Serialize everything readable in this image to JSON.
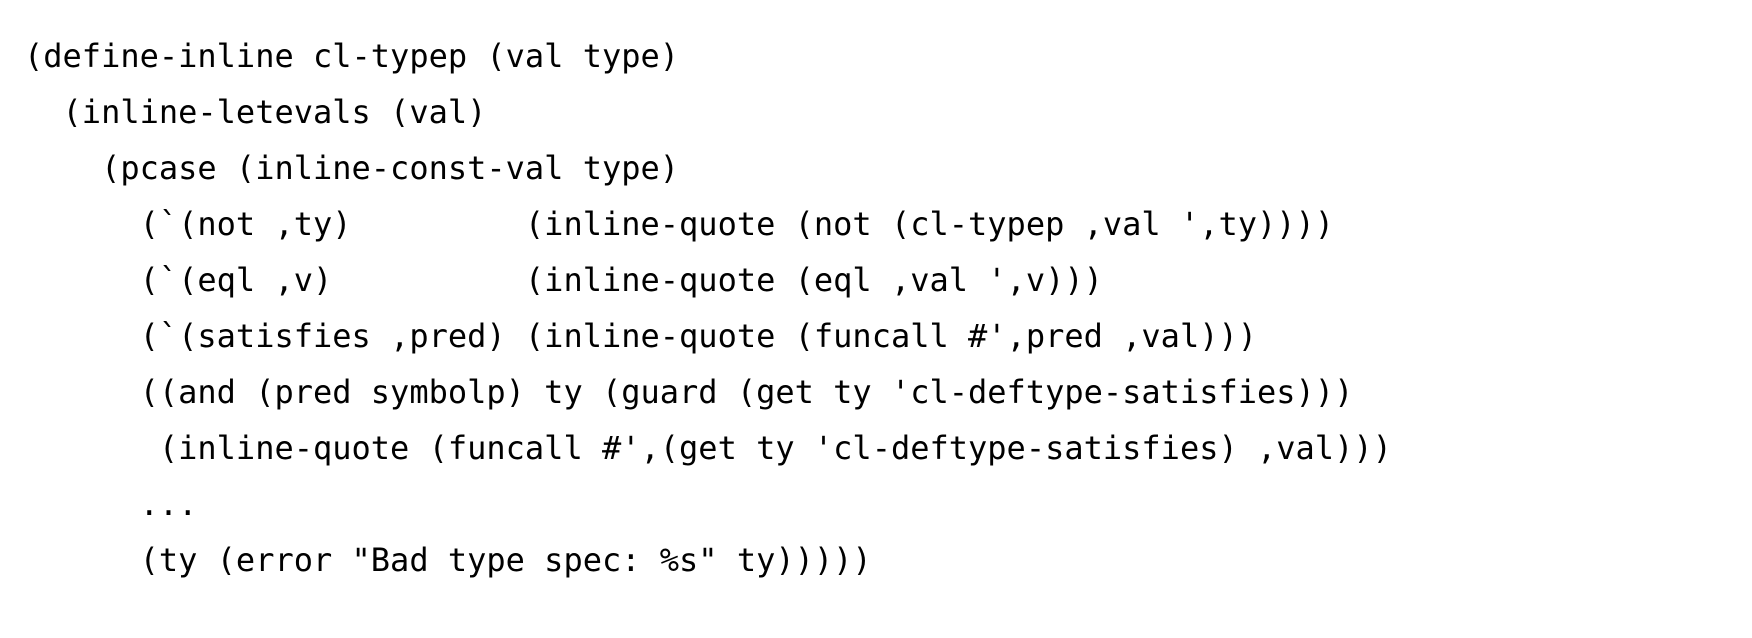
{
  "code": {
    "lines": [
      "(define-inline cl-typep (val type)",
      "  (inline-letevals (val)",
      "    (pcase (inline-const-val type)",
      "      (`(not ,ty)         (inline-quote (not (cl-typep ,val ',ty))))",
      "      (`(eql ,v)          (inline-quote (eql ,val ',v)))",
      "      (`(satisfies ,pred) (inline-quote (funcall #',pred ,val)))",
      "      ((and (pred symbolp) ty (guard (get ty 'cl-deftype-satisfies)))",
      "       (inline-quote (funcall #',(get ty 'cl-deftype-satisfies) ,val)))",
      "      ...",
      "      (ty (error \"Bad type spec: %s\" ty)))))"
    ]
  }
}
